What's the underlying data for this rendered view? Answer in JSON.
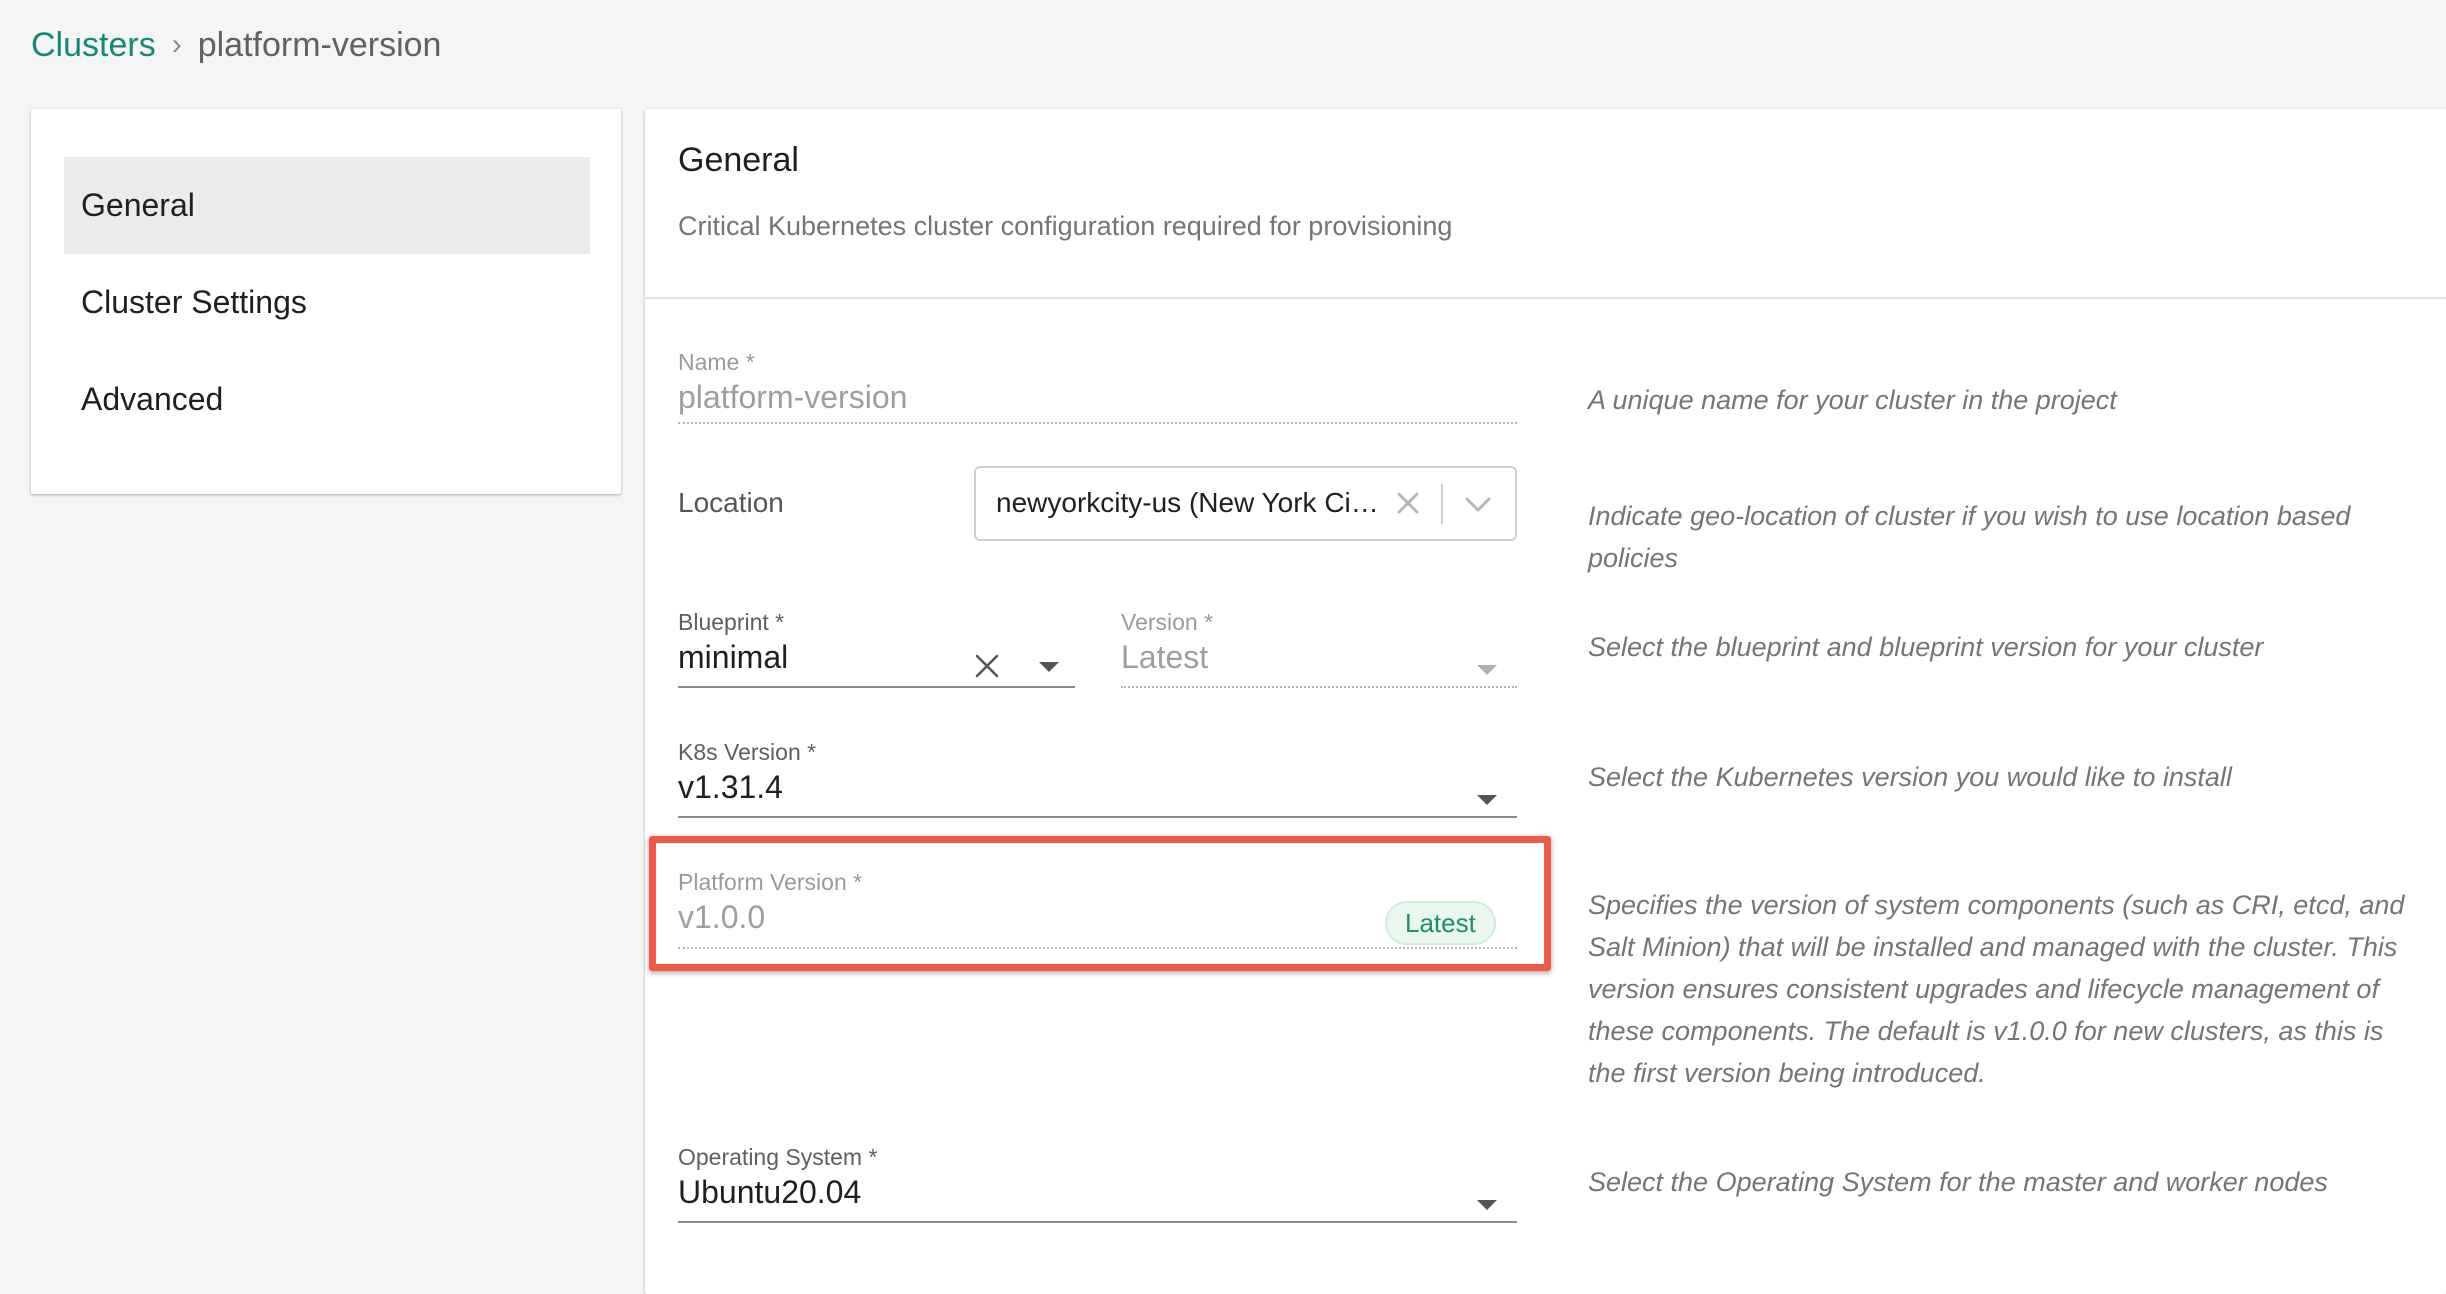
{
  "breadcrumb": {
    "root": "Clusters",
    "separator": "›",
    "current": "platform-version"
  },
  "nav": {
    "items": [
      {
        "label": "General",
        "active": true
      },
      {
        "label": "Cluster Settings",
        "active": false
      },
      {
        "label": "Advanced",
        "active": false
      }
    ]
  },
  "section": {
    "title": "General",
    "subtitle": "Critical Kubernetes cluster configuration required for provisioning"
  },
  "fields": {
    "name": {
      "label": "Name *",
      "value": "platform-version",
      "help": "A unique name for your cluster in the project"
    },
    "location": {
      "label": "Location",
      "value": "newyorkcity-us (New York City, US)",
      "help": "Indicate geo-location of cluster if you wish to use location based policies"
    },
    "blueprint": {
      "label": "Blueprint *",
      "value": "minimal",
      "help": "Select the blueprint and blueprint version for your cluster"
    },
    "blueprint_version": {
      "label": "Version *",
      "value": "Latest"
    },
    "k8s_version": {
      "label": "K8s Version *",
      "value": "v1.31.4",
      "help": "Select the Kubernetes version you would like to install"
    },
    "platform_version": {
      "label": "Platform Version *",
      "value": "v1.0.0",
      "badge": "Latest",
      "help": "Specifies the version of system components (such as CRI, etcd, and Salt Minion) that will be installed and managed with the cluster. This version ensures consistent upgrades and lifecycle management of these components. The default is v1.0.0 for new clusters, as this is the first version being introduced."
    },
    "operating_system": {
      "label": "Operating System *",
      "value": "Ubuntu20.04",
      "help": "Select the Operating System for the master and worker nodes"
    }
  },
  "colors": {
    "link": "#138a78",
    "highlight": "#ef5a48",
    "badge_text": "#1a8f6c",
    "badge_bg": "#e9f7ef"
  }
}
